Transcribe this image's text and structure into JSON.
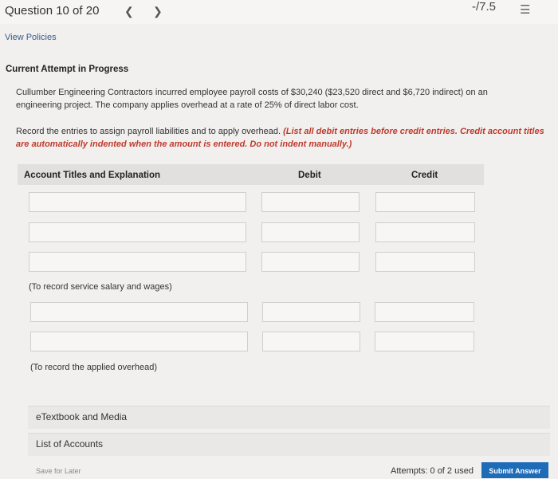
{
  "header": {
    "question_label": "Question 10 of 20",
    "prev_icon": "chevron-left-icon",
    "next_icon": "chevron-right-icon",
    "score": "-/7.5",
    "list_icon": "list-icon"
  },
  "view_policies": "View Policies",
  "attempt_heading": "Current Attempt in Progress",
  "problem": "Cullumber Engineering Contractors incurred employee payroll costs of $30,240 ($23,520 direct and $6,720 indirect) on an engineering project. The company applies overhead at a rate of 25% of direct labor cost.",
  "instructions": {
    "text": "Record the entries to assign payroll liabilities and to apply overhead.",
    "emphasis": "(List all debit entries before credit entries. Credit account titles are automatically indented when the amount is entered. Do not indent manually.)"
  },
  "table": {
    "col_account": "Account Titles and Explanation",
    "col_debit": "Debit",
    "col_credit": "Credit"
  },
  "notes": {
    "entry1": "(To record service salary and wages)",
    "entry2": "(To record the applied overhead)"
  },
  "links": {
    "etextbook": "eTextbook and Media",
    "list_of_accounts": "List of Accounts"
  },
  "footer": {
    "save_for_later": "Save for Later",
    "attempts": "Attempts: 0 of 2 used",
    "submit": "Submit Answer"
  }
}
